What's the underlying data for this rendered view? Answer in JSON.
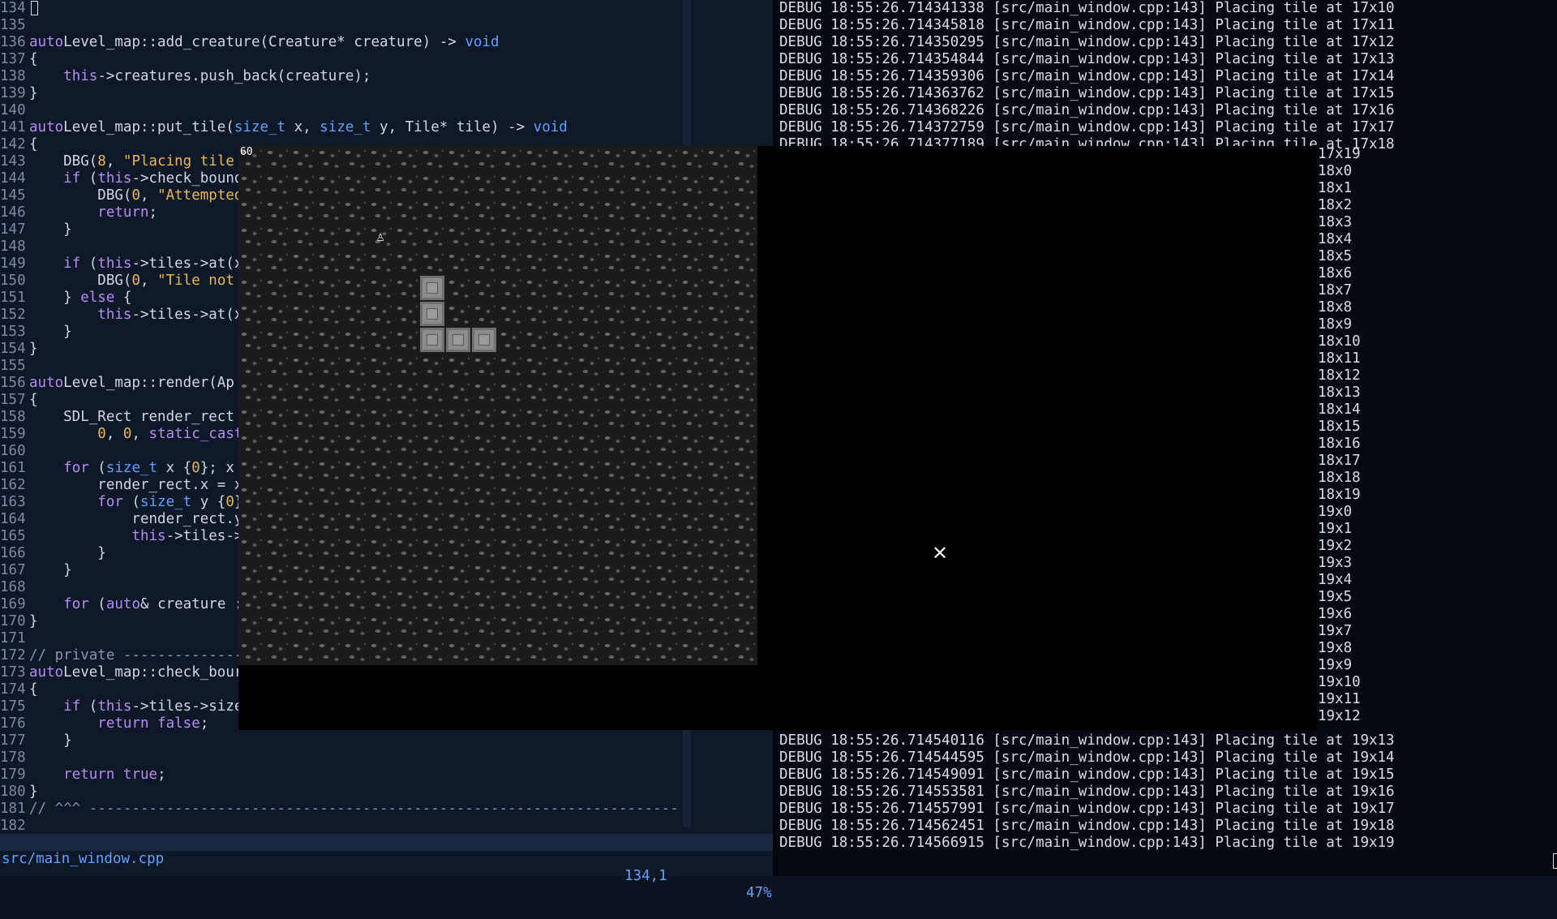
{
  "editor": {
    "lines": [
      {
        "num": "134",
        "cursor": true,
        "parts": []
      },
      {
        "num": "135",
        "parts": []
      },
      {
        "num": "136",
        "parts": [
          [
            "k",
            "auto"
          ],
          [
            "",
            "Level_map::add_creature(Creature* creature) -> "
          ],
          [
            "t",
            "void"
          ]
        ]
      },
      {
        "num": "137",
        "parts": [
          [
            "",
            "{"
          ]
        ]
      },
      {
        "num": "138",
        "parts": [
          [
            "",
            "    "
          ],
          [
            "k",
            "this"
          ],
          [
            "",
            "->creatures.push_back(creature);"
          ]
        ]
      },
      {
        "num": "139",
        "parts": [
          [
            "",
            "}"
          ]
        ]
      },
      {
        "num": "140",
        "parts": []
      },
      {
        "num": "141",
        "parts": [
          [
            "k",
            "auto"
          ],
          [
            "",
            "Level_map::put_tile("
          ],
          [
            "t",
            "size_t"
          ],
          [
            "",
            " x, "
          ],
          [
            "t",
            "size_t"
          ],
          [
            "",
            " y, Tile* tile) -> "
          ],
          [
            "t",
            "void"
          ]
        ]
      },
      {
        "num": "142",
        "parts": [
          [
            "",
            "{"
          ]
        ]
      },
      {
        "num": "143",
        "parts": [
          [
            "",
            "    DBG("
          ],
          [
            "n",
            "8"
          ],
          [
            "",
            ", "
          ],
          [
            "s",
            "\"Placing tile "
          ]
        ]
      },
      {
        "num": "144",
        "parts": [
          [
            "",
            "    "
          ],
          [
            "k",
            "if"
          ],
          [
            "",
            " ("
          ],
          [
            "k",
            "this"
          ],
          [
            "",
            "->check_bound"
          ]
        ]
      },
      {
        "num": "145",
        "parts": [
          [
            "",
            "        DBG("
          ],
          [
            "n",
            "0"
          ],
          [
            "",
            ", "
          ],
          [
            "s",
            "\"Attempted"
          ]
        ]
      },
      {
        "num": "146",
        "parts": [
          [
            "",
            "        "
          ],
          [
            "k",
            "return"
          ],
          [
            "",
            ";"
          ]
        ]
      },
      {
        "num": "147",
        "parts": [
          [
            "",
            "    }"
          ]
        ]
      },
      {
        "num": "148",
        "parts": []
      },
      {
        "num": "149",
        "parts": [
          [
            "",
            "    "
          ],
          [
            "k",
            "if"
          ],
          [
            "",
            " ("
          ],
          [
            "k",
            "this"
          ],
          [
            "",
            "->tiles->at(x"
          ]
        ]
      },
      {
        "num": "150",
        "parts": [
          [
            "",
            "        DBG("
          ],
          [
            "n",
            "0"
          ],
          [
            "",
            ", "
          ],
          [
            "s",
            "\"Tile not"
          ]
        ]
      },
      {
        "num": "151",
        "parts": [
          [
            "",
            "    } "
          ],
          [
            "k",
            "else"
          ],
          [
            "",
            " {"
          ]
        ]
      },
      {
        "num": "152",
        "parts": [
          [
            "",
            "        "
          ],
          [
            "k",
            "this"
          ],
          [
            "",
            "->tiles->at(x"
          ]
        ]
      },
      {
        "num": "153",
        "parts": [
          [
            "",
            "    }"
          ]
        ]
      },
      {
        "num": "154",
        "parts": [
          [
            "",
            "}"
          ]
        ]
      },
      {
        "num": "155",
        "parts": []
      },
      {
        "num": "156",
        "parts": [
          [
            "k",
            "auto"
          ],
          [
            "",
            "Level_map::render(Ap"
          ]
        ]
      },
      {
        "num": "157",
        "parts": [
          [
            "",
            "{"
          ]
        ]
      },
      {
        "num": "158",
        "parts": [
          [
            "",
            "    SDL_Rect render_rect "
          ]
        ]
      },
      {
        "num": "159",
        "parts": [
          [
            "",
            "        "
          ],
          [
            "n",
            "0"
          ],
          [
            "",
            ", "
          ],
          [
            "n",
            "0"
          ],
          [
            "",
            ", "
          ],
          [
            "k",
            "static_cast"
          ]
        ]
      },
      {
        "num": "160",
        "parts": []
      },
      {
        "num": "161",
        "parts": [
          [
            "",
            "    "
          ],
          [
            "k",
            "for"
          ],
          [
            "",
            " ("
          ],
          [
            "t",
            "size_t"
          ],
          [
            "",
            " x {"
          ],
          [
            "n",
            "0"
          ],
          [
            "",
            "}; x "
          ]
        ]
      },
      {
        "num": "162",
        "parts": [
          [
            "",
            "        render_rect.x = x"
          ]
        ]
      },
      {
        "num": "163",
        "parts": [
          [
            "",
            "        "
          ],
          [
            "k",
            "for"
          ],
          [
            "",
            " ("
          ],
          [
            "t",
            "size_t"
          ],
          [
            "",
            " y {"
          ],
          [
            "n",
            "0"
          ],
          [
            "",
            "}"
          ]
        ]
      },
      {
        "num": "164",
        "parts": [
          [
            "",
            "            render_rect.y"
          ]
        ]
      },
      {
        "num": "165",
        "parts": [
          [
            "",
            "            "
          ],
          [
            "k",
            "this"
          ],
          [
            "",
            "->tiles->"
          ]
        ]
      },
      {
        "num": "166",
        "parts": [
          [
            "",
            "        }"
          ]
        ]
      },
      {
        "num": "167",
        "parts": [
          [
            "",
            "    }"
          ]
        ]
      },
      {
        "num": "168",
        "parts": []
      },
      {
        "num": "169",
        "parts": [
          [
            "",
            "    "
          ],
          [
            "k",
            "for"
          ],
          [
            "",
            " ("
          ],
          [
            "k",
            "auto"
          ],
          [
            "",
            "& creature :"
          ]
        ]
      },
      {
        "num": "170",
        "parts": [
          [
            "",
            "}"
          ]
        ]
      },
      {
        "num": "171",
        "parts": []
      },
      {
        "num": "172",
        "parts": [
          [
            "c",
            "// private ---------------"
          ]
        ]
      },
      {
        "num": "173",
        "parts": [
          [
            "k",
            "auto"
          ],
          [
            "",
            "Level_map::check_bour"
          ]
        ]
      },
      {
        "num": "174",
        "parts": [
          [
            "",
            "{"
          ]
        ]
      },
      {
        "num": "175",
        "parts": [
          [
            "",
            "    "
          ],
          [
            "k",
            "if"
          ],
          [
            "",
            " ("
          ],
          [
            "k",
            "this"
          ],
          [
            "",
            "->tiles->size"
          ]
        ]
      },
      {
        "num": "176",
        "parts": [
          [
            "",
            "        "
          ],
          [
            "k",
            "return"
          ],
          [
            "",
            " "
          ],
          [
            "k",
            "false"
          ],
          [
            "",
            ";"
          ]
        ]
      },
      {
        "num": "177",
        "parts": [
          [
            "",
            "    }"
          ]
        ]
      },
      {
        "num": "178",
        "parts": []
      },
      {
        "num": "179",
        "parts": [
          [
            "",
            "    "
          ],
          [
            "k",
            "return"
          ],
          [
            "",
            " "
          ],
          [
            "k",
            "true"
          ],
          [
            "",
            ";"
          ]
        ]
      },
      {
        "num": "180",
        "parts": [
          [
            "",
            "}"
          ]
        ]
      },
      {
        "num": "181",
        "parts": [
          [
            "c",
            "// ^^^ ---------------------------------------------------------------------"
          ]
        ]
      },
      {
        "num": "182",
        "parts": []
      }
    ]
  },
  "statusline": {
    "file": "src/main_window.cpp",
    "position": "134,1",
    "percent": "47%"
  },
  "log": {
    "top_lines": [
      "DEBUG 18:55:26.714341338 [src/main_window.cpp:143] Placing tile at 17x10",
      "DEBUG 18:55:26.714345818 [src/main_window.cpp:143] Placing tile at 17x11",
      "DEBUG 18:55:26.714350295 [src/main_window.cpp:143] Placing tile at 17x12",
      "DEBUG 18:55:26.714354844 [src/main_window.cpp:143] Placing tile at 17x13",
      "DEBUG 18:55:26.714359306 [src/main_window.cpp:143] Placing tile at 17x14",
      "DEBUG 18:55:26.714363762 [src/main_window.cpp:143] Placing tile at 17x15",
      "DEBUG 18:55:26.714368226 [src/main_window.cpp:143] Placing tile at 17x16",
      "DEBUG 18:55:26.714372759 [src/main_window.cpp:143] Placing tile at 17x17",
      "DEBUG 18:55:26.714377189 [src/main_window.cpp:143] Placing tile at 17x18"
    ],
    "visible_tail": [
      "17x19",
      "18x0",
      "18x1",
      "18x2",
      "18x3",
      "18x4",
      "18x5",
      "18x6",
      "18x7",
      "18x8",
      "18x9",
      "18x10",
      "18x11",
      "18x12",
      "18x13",
      "18x14",
      "18x15",
      "18x16",
      "18x17",
      "18x18",
      "18x19",
      "19x0",
      "19x1",
      "19x2",
      "19x3",
      "19x4",
      "19x5",
      "19x6",
      "19x7",
      "19x8",
      "19x9",
      "19x10",
      "19x11",
      "19x12"
    ],
    "bottom_lines": [
      "DEBUG 18:55:26.714540116 [src/main_window.cpp:143] Placing tile at 19x13",
      "DEBUG 18:55:26.714544595 [src/main_window.cpp:143] Placing tile at 19x14",
      "DEBUG 18:55:26.714549091 [src/main_window.cpp:143] Placing tile at 19x15",
      "DEBUG 18:55:26.714553581 [src/main_window.cpp:143] Placing tile at 19x16",
      "DEBUG 18:55:26.714557991 [src/main_window.cpp:143] Placing tile at 19x17",
      "DEBUG 18:55:26.714562451 [src/main_window.cpp:143] Placing tile at 19x18",
      "DEBUG 18:55:26.714566915 [src/main_window.cpp:143] Placing tile at 19x19"
    ]
  },
  "game": {
    "fps": "60",
    "creature_glyph": "♙",
    "cursor_glyph": "✕"
  },
  "colors": {
    "editor_bg": "#0f1829",
    "log_bg": "#05080f",
    "keyword": "#b58cf0",
    "type": "#5fa0ff",
    "string": "#e9b856",
    "statusline_fg": "#5fa0ff"
  }
}
